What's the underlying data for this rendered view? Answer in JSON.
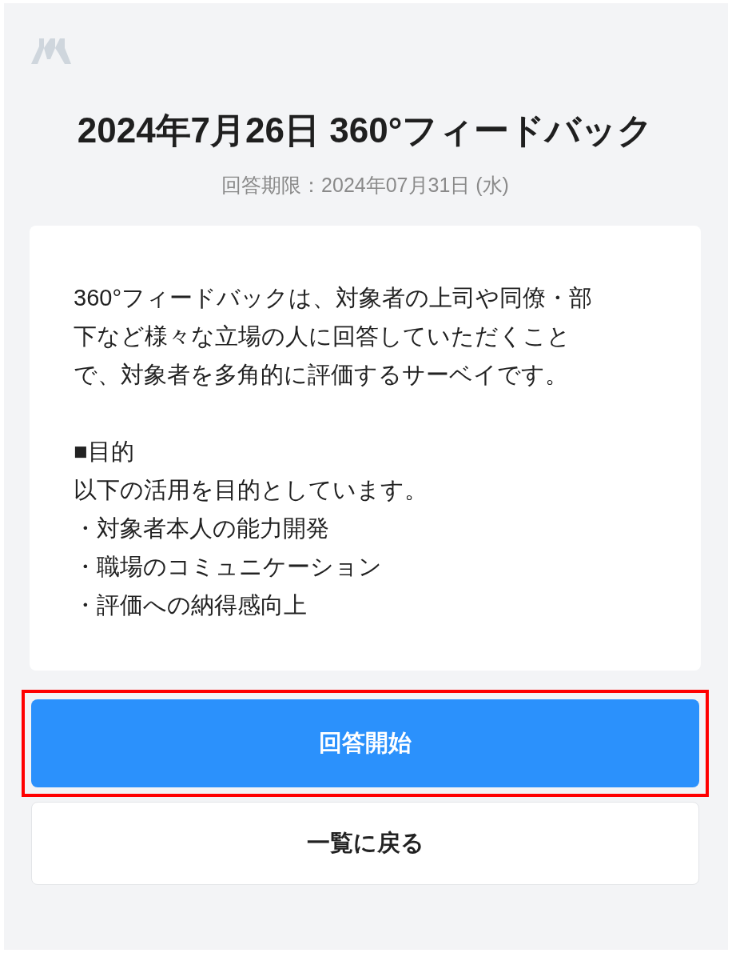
{
  "title": "2024年7月26日 360°フィードバック",
  "deadline": "回答期限：2024年07月31日 (水)",
  "description": {
    "intro": "360°フィードバックは、対象者の上司や同僚・部下など様々な立場の人に回答していただくことで、対象者を多角的に評価するサーベイです。",
    "purpose_heading": "■目的",
    "purpose_intro": "以下の活用を目的としています。",
    "purpose_items": [
      "・対象者本人の能力開発",
      "・職場のコミュニケーション",
      "・評価への納得感向上"
    ]
  },
  "buttons": [
    {
      "label": "回答開始",
      "kind": "primary",
      "highlighted": true
    },
    {
      "label": "一覧に戻る",
      "kind": "secondary",
      "highlighted": false
    }
  ]
}
